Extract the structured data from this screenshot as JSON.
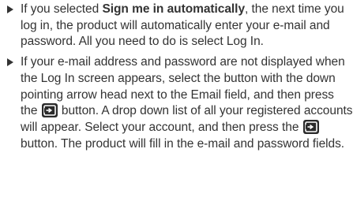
{
  "bullets": [
    {
      "text_before_bold": "If you selected ",
      "bold": "Sign me in automatically",
      "text_after_bold": ", the next time you log in, the product will automatically enter your e-mail and password. All you need to do is select Log In."
    },
    {
      "segment_1": "If your e-mail address and password are not displayed when the Log In screen appears, select the button with the down pointing arrow head next to the Email field, and then press the ",
      "segment_2": " button. A drop down list of all your registered accounts will appear. Select your account, and then press the ",
      "segment_3": " button. The product will fill in the e-mail and password fields."
    }
  ],
  "icons": {
    "bullet_marker": "triangle-right-icon",
    "remote_button": "enter-key-icon"
  }
}
